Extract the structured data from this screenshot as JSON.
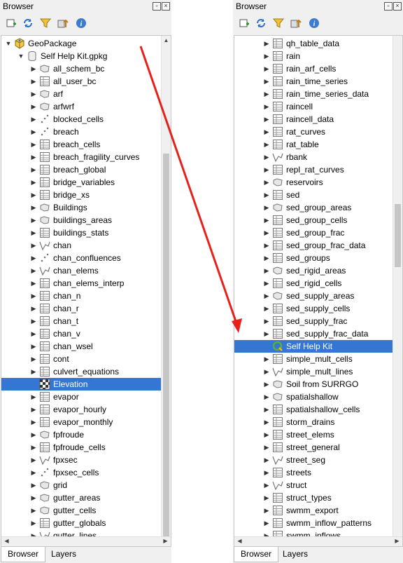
{
  "colors": {
    "selection": "#3376d4",
    "arrow": "#e8201a"
  },
  "left": {
    "title": "Browser",
    "tabs": [
      "Browser",
      "Layers"
    ],
    "items": [
      {
        "label": "GeoPackage",
        "icon": "geopackage",
        "depth": 0,
        "arrow": "expanded"
      },
      {
        "label": "Self Help Kit.gpkg",
        "icon": "database",
        "depth": 1,
        "arrow": "expanded"
      },
      {
        "label": "all_schem_bc",
        "icon": "polygon",
        "depth": 2,
        "arrow": "collapsed"
      },
      {
        "label": "all_user_bc",
        "icon": "table",
        "depth": 2,
        "arrow": "collapsed"
      },
      {
        "label": "arf",
        "icon": "polygon",
        "depth": 2,
        "arrow": "collapsed"
      },
      {
        "label": "arfwrf",
        "icon": "polygon",
        "depth": 2,
        "arrow": "collapsed"
      },
      {
        "label": "blocked_cells",
        "icon": "point",
        "depth": 2,
        "arrow": "collapsed"
      },
      {
        "label": "breach",
        "icon": "point",
        "depth": 2,
        "arrow": "collapsed"
      },
      {
        "label": "breach_cells",
        "icon": "table",
        "depth": 2,
        "arrow": "collapsed"
      },
      {
        "label": "breach_fragility_curves",
        "icon": "table",
        "depth": 2,
        "arrow": "collapsed"
      },
      {
        "label": "breach_global",
        "icon": "table",
        "depth": 2,
        "arrow": "collapsed"
      },
      {
        "label": "bridge_variables",
        "icon": "table",
        "depth": 2,
        "arrow": "collapsed"
      },
      {
        "label": "bridge_xs",
        "icon": "table",
        "depth": 2,
        "arrow": "collapsed"
      },
      {
        "label": "Buildings",
        "icon": "polygon",
        "depth": 2,
        "arrow": "collapsed"
      },
      {
        "label": "buildings_areas",
        "icon": "polygon",
        "depth": 2,
        "arrow": "collapsed"
      },
      {
        "label": "buildings_stats",
        "icon": "table",
        "depth": 2,
        "arrow": "collapsed"
      },
      {
        "label": "chan",
        "icon": "line",
        "depth": 2,
        "arrow": "collapsed"
      },
      {
        "label": "chan_confluences",
        "icon": "point",
        "depth": 2,
        "arrow": "collapsed"
      },
      {
        "label": "chan_elems",
        "icon": "line",
        "depth": 2,
        "arrow": "collapsed"
      },
      {
        "label": "chan_elems_interp",
        "icon": "table",
        "depth": 2,
        "arrow": "collapsed"
      },
      {
        "label": "chan_n",
        "icon": "table",
        "depth": 2,
        "arrow": "collapsed"
      },
      {
        "label": "chan_r",
        "icon": "table",
        "depth": 2,
        "arrow": "collapsed"
      },
      {
        "label": "chan_t",
        "icon": "table",
        "depth": 2,
        "arrow": "collapsed"
      },
      {
        "label": "chan_v",
        "icon": "table",
        "depth": 2,
        "arrow": "collapsed"
      },
      {
        "label": "chan_wsel",
        "icon": "table",
        "depth": 2,
        "arrow": "collapsed"
      },
      {
        "label": "cont",
        "icon": "table",
        "depth": 2,
        "arrow": "collapsed"
      },
      {
        "label": "culvert_equations",
        "icon": "table",
        "depth": 2,
        "arrow": "collapsed"
      },
      {
        "label": "Elevation",
        "icon": "raster",
        "depth": 2,
        "arrow": "none",
        "selected": true
      },
      {
        "label": "evapor",
        "icon": "table",
        "depth": 2,
        "arrow": "collapsed"
      },
      {
        "label": "evapor_hourly",
        "icon": "table",
        "depth": 2,
        "arrow": "collapsed"
      },
      {
        "label": "evapor_monthly",
        "icon": "table",
        "depth": 2,
        "arrow": "collapsed"
      },
      {
        "label": "fpfroude",
        "icon": "polygon",
        "depth": 2,
        "arrow": "collapsed"
      },
      {
        "label": "fpfroude_cells",
        "icon": "table",
        "depth": 2,
        "arrow": "collapsed"
      },
      {
        "label": "fpxsec",
        "icon": "line",
        "depth": 2,
        "arrow": "collapsed"
      },
      {
        "label": "fpxsec_cells",
        "icon": "point",
        "depth": 2,
        "arrow": "collapsed"
      },
      {
        "label": "grid",
        "icon": "polygon",
        "depth": 2,
        "arrow": "collapsed"
      },
      {
        "label": "gutter_areas",
        "icon": "polygon",
        "depth": 2,
        "arrow": "collapsed"
      },
      {
        "label": "gutter_cells",
        "icon": "polygon",
        "depth": 2,
        "arrow": "collapsed"
      },
      {
        "label": "gutter_globals",
        "icon": "table",
        "depth": 2,
        "arrow": "collapsed"
      },
      {
        "label": "gutter_lines",
        "icon": "line",
        "depth": 2,
        "arrow": "collapsed"
      }
    ]
  },
  "right": {
    "title": "Browser",
    "tabs": [
      "Browser",
      "Layers"
    ],
    "items": [
      {
        "label": "qh_table_data",
        "icon": "table",
        "depth": 2,
        "arrow": "collapsed"
      },
      {
        "label": "rain",
        "icon": "table",
        "depth": 2,
        "arrow": "collapsed"
      },
      {
        "label": "rain_arf_cells",
        "icon": "table",
        "depth": 2,
        "arrow": "collapsed"
      },
      {
        "label": "rain_time_series",
        "icon": "table",
        "depth": 2,
        "arrow": "collapsed"
      },
      {
        "label": "rain_time_series_data",
        "icon": "table",
        "depth": 2,
        "arrow": "collapsed"
      },
      {
        "label": "raincell",
        "icon": "table",
        "depth": 2,
        "arrow": "collapsed"
      },
      {
        "label": "raincell_data",
        "icon": "table",
        "depth": 2,
        "arrow": "collapsed"
      },
      {
        "label": "rat_curves",
        "icon": "table",
        "depth": 2,
        "arrow": "collapsed"
      },
      {
        "label": "rat_table",
        "icon": "table",
        "depth": 2,
        "arrow": "collapsed"
      },
      {
        "label": "rbank",
        "icon": "line",
        "depth": 2,
        "arrow": "collapsed"
      },
      {
        "label": "repl_rat_curves",
        "icon": "table",
        "depth": 2,
        "arrow": "collapsed"
      },
      {
        "label": "reservoirs",
        "icon": "polygon",
        "depth": 2,
        "arrow": "collapsed"
      },
      {
        "label": "sed",
        "icon": "table",
        "depth": 2,
        "arrow": "collapsed"
      },
      {
        "label": "sed_group_areas",
        "icon": "polygon",
        "depth": 2,
        "arrow": "collapsed"
      },
      {
        "label": "sed_group_cells",
        "icon": "table",
        "depth": 2,
        "arrow": "collapsed"
      },
      {
        "label": "sed_group_frac",
        "icon": "table",
        "depth": 2,
        "arrow": "collapsed"
      },
      {
        "label": "sed_group_frac_data",
        "icon": "table",
        "depth": 2,
        "arrow": "collapsed"
      },
      {
        "label": "sed_groups",
        "icon": "table",
        "depth": 2,
        "arrow": "collapsed"
      },
      {
        "label": "sed_rigid_areas",
        "icon": "polygon",
        "depth": 2,
        "arrow": "collapsed"
      },
      {
        "label": "sed_rigid_cells",
        "icon": "table",
        "depth": 2,
        "arrow": "collapsed"
      },
      {
        "label": "sed_supply_areas",
        "icon": "polygon",
        "depth": 2,
        "arrow": "collapsed"
      },
      {
        "label": "sed_supply_cells",
        "icon": "table",
        "depth": 2,
        "arrow": "collapsed"
      },
      {
        "label": "sed_supply_frac",
        "icon": "table",
        "depth": 2,
        "arrow": "collapsed"
      },
      {
        "label": "sed_supply_frac_data",
        "icon": "table",
        "depth": 2,
        "arrow": "collapsed"
      },
      {
        "label": "Self Help Kit",
        "icon": "qgis",
        "depth": 2,
        "arrow": "none",
        "selected": true
      },
      {
        "label": "simple_mult_cells",
        "icon": "table",
        "depth": 2,
        "arrow": "collapsed"
      },
      {
        "label": "simple_mult_lines",
        "icon": "line",
        "depth": 2,
        "arrow": "collapsed"
      },
      {
        "label": "Soil from SURRGO",
        "icon": "polygon",
        "depth": 2,
        "arrow": "collapsed"
      },
      {
        "label": "spatialshallow",
        "icon": "polygon",
        "depth": 2,
        "arrow": "collapsed"
      },
      {
        "label": "spatialshallow_cells",
        "icon": "table",
        "depth": 2,
        "arrow": "collapsed"
      },
      {
        "label": "storm_drains",
        "icon": "table",
        "depth": 2,
        "arrow": "collapsed"
      },
      {
        "label": "street_elems",
        "icon": "table",
        "depth": 2,
        "arrow": "collapsed"
      },
      {
        "label": "street_general",
        "icon": "table",
        "depth": 2,
        "arrow": "collapsed"
      },
      {
        "label": "street_seg",
        "icon": "line",
        "depth": 2,
        "arrow": "collapsed"
      },
      {
        "label": "streets",
        "icon": "table",
        "depth": 2,
        "arrow": "collapsed"
      },
      {
        "label": "struct",
        "icon": "line",
        "depth": 2,
        "arrow": "collapsed"
      },
      {
        "label": "struct_types",
        "icon": "table",
        "depth": 2,
        "arrow": "collapsed"
      },
      {
        "label": "swmm_export",
        "icon": "table",
        "depth": 2,
        "arrow": "collapsed"
      },
      {
        "label": "swmm_inflow_patterns",
        "icon": "table",
        "depth": 2,
        "arrow": "collapsed"
      },
      {
        "label": "swmm_inflows",
        "icon": "table",
        "depth": 2,
        "arrow": "collapsed"
      }
    ]
  }
}
